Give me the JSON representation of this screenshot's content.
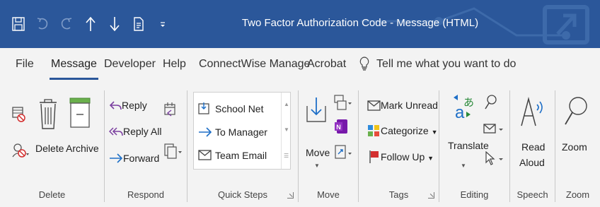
{
  "window": {
    "title": "Two Factor Authorization Code  -  Message (HTML)"
  },
  "tabs": [
    {
      "label": "File"
    },
    {
      "label": "Message"
    },
    {
      "label": "Developer"
    },
    {
      "label": "Help"
    },
    {
      "label": "ConnectWise Manage"
    },
    {
      "label": "Acrobat"
    }
  ],
  "tellme": {
    "label": "Tell me what you want to do"
  },
  "groups": {
    "delete": {
      "label": "Delete",
      "delete_btn": "Delete",
      "archive_btn": "Archive"
    },
    "respond": {
      "label": "Respond",
      "reply": "Reply",
      "reply_all": "Reply All",
      "forward": "Forward"
    },
    "quicksteps": {
      "label": "Quick Steps",
      "items": [
        "School Net",
        "To Manager",
        "Team Email"
      ]
    },
    "move": {
      "label": "Move",
      "move_btn": "Move"
    },
    "tags": {
      "label": "Tags",
      "mark_unread": "Mark Unread",
      "categorize": "Categorize",
      "follow_up": "Follow Up"
    },
    "editing": {
      "label": "Editing",
      "translate": "Translate"
    },
    "speech": {
      "label": "Speech",
      "read_aloud_1": "Read",
      "read_aloud_2": "Aloud"
    },
    "zoom": {
      "label": "Zoom",
      "zoom_btn": "Zoom"
    }
  },
  "colors": {
    "title_bar": "#2b579a",
    "accent": "#2b579a",
    "reply_purple": "#7b3fa0",
    "forward_blue": "#1e6fc7",
    "flag_red": "#d32f2f"
  }
}
